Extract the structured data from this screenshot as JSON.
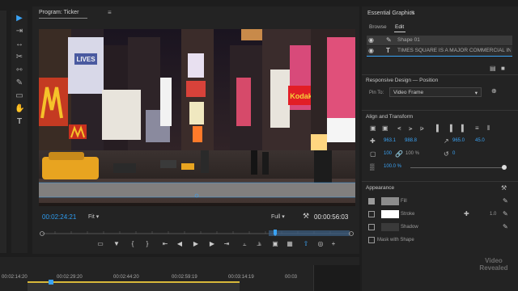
{
  "program": {
    "tab_label": "Program: Ticker",
    "timecode_current": "00:02:24:21",
    "fit_label": "Fit",
    "quality_label": "Full",
    "timecode_duration": "00:00:56:03"
  },
  "video": {
    "signs": [
      "LIVES",
      "Kodak",
      "McDonald's"
    ]
  },
  "timeline": {
    "ruler_labels": [
      "00:02:14:20",
      "00:02:29:20",
      "00:02:44:20",
      "00:02:59:19",
      "00:03:14:19",
      "00:03"
    ]
  },
  "essential_graphics": {
    "title": "Essential Graphics",
    "tabs": [
      "Browse",
      "Edit"
    ],
    "active_tab": "Edit",
    "layers": [
      {
        "name": "Shape 01",
        "icon": "pen-icon"
      },
      {
        "name": "TIMES SQUARE IS A MAJOR COMMERCIAL INTE...",
        "icon": "text-icon"
      }
    ],
    "responsive_header": "Responsive Design — Position",
    "pin_to_label": "Pin To:",
    "pin_to_value": "Video Frame",
    "align_header": "Align and Transform",
    "position_x": "963.1",
    "position_y": "988.8",
    "anchor_x": "965.0",
    "anchor_y": "45.0",
    "scale": "100",
    "scale_pct": "100 %",
    "rotation": "0",
    "opacity": "100.0 %",
    "appearance_header": "Appearance",
    "fill_label": "Fill",
    "stroke_label": "Stroke",
    "stroke_value": "1.0",
    "shadow_label": "Shadow",
    "mask_label": "Mask with Shape",
    "fill_checked": true,
    "stroke_checked": false,
    "shadow_checked": false,
    "colors": {
      "fill": "#8c8c8c",
      "stroke": "#ffffff",
      "shadow": "#3a3a3a"
    }
  },
  "watermark": {
    "line1": "Video",
    "line2": "Revealed"
  },
  "colors": {
    "accent": "#3aa3f5",
    "panel": "#232323",
    "background": "#1d1d1d"
  }
}
